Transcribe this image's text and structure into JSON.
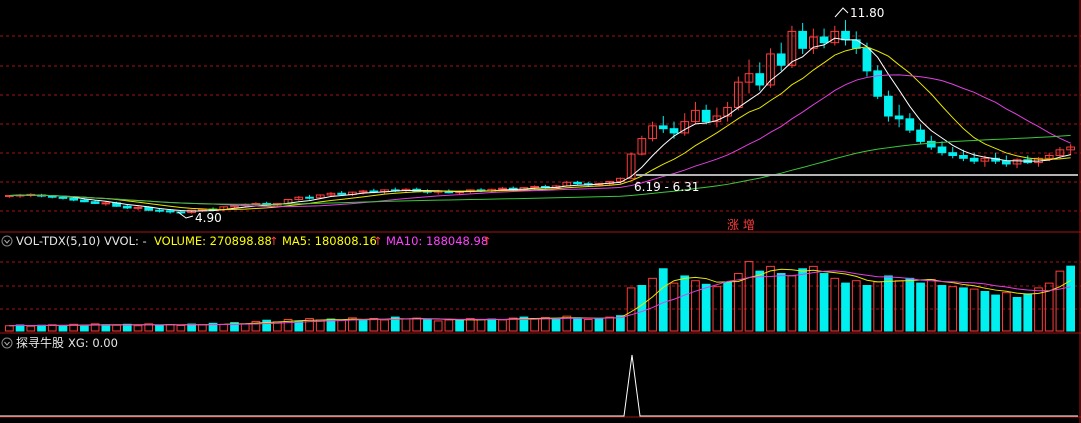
{
  "colors": {
    "background": "#000000",
    "grid": "#a01414",
    "up": "#ff3c3c",
    "down": "#00f0f0",
    "ma_white": "#ffffff",
    "ma_yellow": "#e6e600",
    "ma_magenta": "#e040e0",
    "ma_green": "#3cc83c",
    "support": "#b4b4b4",
    "panel_label": "#e6e6e6",
    "volume_label": "#ffff00",
    "ma5_label": "#ffff00",
    "ma10_label": "#ff40ff",
    "xg_line": "#ffffff",
    "annotation": "#ffffff"
  },
  "price_panel": {
    "high_annotation": "11.80",
    "low_annotation": "4.90",
    "range_annotation": "6.19 - 6.31",
    "signal_text": "涨   增"
  },
  "volume_panel": {
    "indicator": "VOL-TDX(5,10)",
    "vvol": "VVOL: -",
    "volume": "VOLUME: 270898.88",
    "ma5": "MA5: 180808.16",
    "ma10": "MA10: 188048.98",
    "up_arrow": "↑"
  },
  "xg_panel": {
    "title": "探寻牛股",
    "value": "XG: 0.00"
  },
  "chart_data": {
    "type": "candlestick",
    "price": {
      "ylim": [
        4.5,
        12.3
      ],
      "support_level": 6.31,
      "ohlc_profile": [
        [
          5.55,
          5.6,
          5.5,
          5.58
        ],
        [
          5.58,
          5.64,
          5.5,
          5.6
        ],
        [
          5.6,
          5.66,
          5.52,
          5.62
        ],
        [
          5.6,
          5.64,
          5.52,
          5.56
        ],
        [
          5.56,
          5.6,
          5.48,
          5.52
        ],
        [
          5.52,
          5.58,
          5.44,
          5.48
        ],
        [
          5.48,
          5.52,
          5.38,
          5.42
        ],
        [
          5.42,
          5.46,
          5.34,
          5.36
        ],
        [
          5.36,
          5.42,
          5.28,
          5.3
        ],
        [
          5.3,
          5.38,
          5.22,
          5.32
        ],
        [
          5.32,
          5.36,
          5.18,
          5.2
        ],
        [
          5.2,
          5.26,
          5.1,
          5.14
        ],
        [
          5.14,
          5.2,
          5.06,
          5.16
        ],
        [
          5.16,
          5.2,
          5.02,
          5.06
        ],
        [
          5.06,
          5.12,
          4.98,
          5.04
        ],
        [
          5.04,
          5.1,
          4.94,
          5.0
        ],
        [
          5.0,
          5.06,
          4.9,
          4.98
        ],
        [
          4.98,
          5.08,
          4.94,
          5.06
        ],
        [
          5.06,
          5.12,
          5.0,
          5.1
        ],
        [
          5.1,
          5.16,
          5.02,
          5.08
        ],
        [
          5.08,
          5.2,
          5.04,
          5.18
        ],
        [
          5.18,
          5.26,
          5.12,
          5.22
        ],
        [
          5.22,
          5.3,
          5.16,
          5.26
        ],
        [
          5.26,
          5.34,
          5.2,
          5.3
        ],
        [
          5.3,
          5.36,
          5.22,
          5.24
        ],
        [
          5.24,
          5.32,
          5.18,
          5.3
        ],
        [
          5.3,
          5.46,
          5.26,
          5.44
        ],
        [
          5.44,
          5.56,
          5.4,
          5.52
        ],
        [
          5.52,
          5.6,
          5.44,
          5.5
        ],
        [
          5.5,
          5.62,
          5.46,
          5.6
        ],
        [
          5.6,
          5.7,
          5.54,
          5.66
        ],
        [
          5.66,
          5.74,
          5.58,
          5.62
        ],
        [
          5.62,
          5.72,
          5.56,
          5.7
        ],
        [
          5.7,
          5.78,
          5.62,
          5.74
        ],
        [
          5.74,
          5.82,
          5.66,
          5.72
        ],
        [
          5.72,
          5.8,
          5.64,
          5.78
        ],
        [
          5.78,
          5.86,
          5.7,
          5.76
        ],
        [
          5.76,
          5.84,
          5.68,
          5.8
        ],
        [
          5.8,
          5.86,
          5.72,
          5.74
        ],
        [
          5.74,
          5.8,
          5.64,
          5.7
        ],
        [
          5.7,
          5.78,
          5.62,
          5.74
        ],
        [
          5.74,
          5.8,
          5.66,
          5.68
        ],
        [
          5.68,
          5.76,
          5.6,
          5.72
        ],
        [
          5.72,
          5.8,
          5.66,
          5.78
        ],
        [
          5.78,
          5.84,
          5.7,
          5.74
        ],
        [
          5.74,
          5.82,
          5.68,
          5.8
        ],
        [
          5.8,
          5.88,
          5.74,
          5.84
        ],
        [
          5.84,
          5.9,
          5.76,
          5.8
        ],
        [
          5.8,
          5.88,
          5.74,
          5.86
        ],
        [
          5.86,
          5.94,
          5.8,
          5.9
        ],
        [
          5.9,
          5.96,
          5.82,
          5.86
        ],
        [
          5.86,
          5.96,
          5.82,
          5.92
        ],
        [
          5.92,
          6.1,
          5.9,
          6.05
        ],
        [
          6.05,
          6.1,
          5.96,
          6.0
        ],
        [
          6.0,
          6.06,
          5.92,
          5.96
        ],
        [
          5.96,
          6.04,
          5.9,
          6.0
        ],
        [
          6.0,
          6.1,
          5.95,
          6.08
        ],
        [
          6.08,
          6.22,
          6.0,
          6.19
        ],
        [
          6.19,
          7.1,
          6.19,
          7.05
        ],
        [
          7.05,
          7.7,
          7.0,
          7.6
        ],
        [
          7.6,
          8.2,
          7.5,
          8.05
        ],
        [
          8.05,
          8.4,
          7.8,
          7.95
        ],
        [
          7.95,
          8.2,
          7.6,
          7.8
        ],
        [
          7.8,
          8.5,
          7.7,
          8.2
        ],
        [
          8.2,
          8.9,
          8.1,
          8.6
        ],
        [
          8.6,
          8.8,
          8.1,
          8.2
        ],
        [
          8.2,
          8.7,
          8.0,
          8.4
        ],
        [
          8.4,
          8.9,
          8.2,
          8.7
        ],
        [
          8.7,
          9.8,
          8.6,
          9.6
        ],
        [
          9.6,
          10.4,
          9.2,
          9.9
        ],
        [
          9.9,
          10.3,
          9.3,
          9.5
        ],
        [
          9.5,
          10.8,
          9.4,
          10.6
        ],
        [
          10.6,
          11.0,
          10.0,
          10.2
        ],
        [
          10.2,
          11.6,
          10.1,
          11.4
        ],
        [
          11.4,
          11.7,
          10.6,
          10.8
        ],
        [
          10.8,
          11.5,
          10.6,
          11.2
        ],
        [
          11.2,
          11.5,
          10.8,
          11.0
        ],
        [
          11.0,
          11.6,
          10.9,
          11.4
        ],
        [
          11.4,
          11.8,
          10.9,
          11.1
        ],
        [
          11.1,
          11.4,
          10.6,
          10.8
        ],
        [
          10.8,
          11.0,
          9.8,
          10.0
        ],
        [
          10.0,
          10.2,
          9.0,
          9.1
        ],
        [
          9.1,
          9.3,
          8.2,
          8.4
        ],
        [
          8.4,
          8.8,
          8.0,
          8.3
        ],
        [
          8.3,
          8.5,
          7.8,
          7.9
        ],
        [
          7.9,
          8.1,
          7.4,
          7.5
        ],
        [
          7.5,
          7.7,
          7.2,
          7.3
        ],
        [
          7.3,
          7.5,
          7.0,
          7.1
        ],
        [
          7.1,
          7.3,
          6.9,
          7.0
        ],
        [
          7.0,
          7.2,
          6.8,
          6.9
        ],
        [
          6.9,
          7.1,
          6.7,
          6.8
        ],
        [
          6.8,
          7.0,
          6.6,
          6.9
        ],
        [
          6.9,
          7.1,
          6.7,
          6.8
        ],
        [
          6.8,
          7.0,
          6.6,
          6.7
        ],
        [
          6.7,
          6.9,
          6.55,
          6.85
        ],
        [
          6.85,
          7.0,
          6.7,
          6.75
        ],
        [
          6.75,
          6.95,
          6.6,
          6.9
        ],
        [
          6.9,
          7.1,
          6.8,
          7.0
        ],
        [
          7.0,
          7.3,
          6.9,
          7.2
        ],
        [
          7.2,
          7.4,
          7.0,
          7.3
        ]
      ]
    },
    "volume": {
      "ylim": [
        0,
        330000
      ],
      "series_profile": [
        [
          22000,
          1
        ],
        [
          25000,
          0
        ],
        [
          20000,
          1
        ],
        [
          24000,
          0
        ],
        [
          26000,
          1
        ],
        [
          23000,
          0
        ],
        [
          28000,
          1
        ],
        [
          22000,
          0
        ],
        [
          30000,
          1
        ],
        [
          26000,
          0
        ],
        [
          24000,
          1
        ],
        [
          28000,
          0
        ],
        [
          22000,
          1
        ],
        [
          30000,
          1
        ],
        [
          25000,
          0
        ],
        [
          27000,
          1
        ],
        [
          23000,
          1
        ],
        [
          29000,
          0
        ],
        [
          26000,
          1
        ],
        [
          32000,
          0
        ],
        [
          28000,
          1
        ],
        [
          35000,
          0
        ],
        [
          30000,
          1
        ],
        [
          40000,
          1
        ],
        [
          45000,
          0
        ],
        [
          38000,
          1
        ],
        [
          48000,
          1
        ],
        [
          42000,
          0
        ],
        [
          52000,
          1
        ],
        [
          46000,
          1
        ],
        [
          50000,
          0
        ],
        [
          44000,
          1
        ],
        [
          55000,
          1
        ],
        [
          48000,
          0
        ],
        [
          52000,
          1
        ],
        [
          46000,
          1
        ],
        [
          58000,
          0
        ],
        [
          50000,
          1
        ],
        [
          54000,
          1
        ],
        [
          48000,
          0
        ],
        [
          42000,
          1
        ],
        [
          46000,
          1
        ],
        [
          44000,
          0
        ],
        [
          52000,
          1
        ],
        [
          48000,
          1
        ],
        [
          50000,
          0
        ],
        [
          46000,
          1
        ],
        [
          54000,
          1
        ],
        [
          58000,
          0
        ],
        [
          52000,
          1
        ],
        [
          56000,
          1
        ],
        [
          50000,
          0
        ],
        [
          62000,
          1
        ],
        [
          55000,
          0
        ],
        [
          48000,
          1
        ],
        [
          52000,
          0
        ],
        [
          58000,
          1
        ],
        [
          64000,
          0
        ],
        [
          180000,
          1
        ],
        [
          190000,
          0
        ],
        [
          220000,
          1
        ],
        [
          260000,
          0
        ],
        [
          200000,
          1
        ],
        [
          230000,
          0
        ],
        [
          210000,
          1
        ],
        [
          195000,
          0
        ],
        [
          185000,
          1
        ],
        [
          205000,
          0
        ],
        [
          240000,
          1
        ],
        [
          290000,
          1
        ],
        [
          250000,
          0
        ],
        [
          270000,
          1
        ],
        [
          240000,
          0
        ],
        [
          230000,
          1
        ],
        [
          260000,
          0
        ],
        [
          270000,
          1
        ],
        [
          240000,
          0
        ],
        [
          220000,
          1
        ],
        [
          200000,
          0
        ],
        [
          210000,
          1
        ],
        [
          190000,
          0
        ],
        [
          205000,
          1
        ],
        [
          230000,
          0
        ],
        [
          210000,
          1
        ],
        [
          220000,
          0
        ],
        [
          200000,
          0
        ],
        [
          215000,
          1
        ],
        [
          190000,
          0
        ],
        [
          185000,
          1
        ],
        [
          180000,
          0
        ],
        [
          175000,
          1
        ],
        [
          165000,
          0
        ],
        [
          150000,
          0
        ],
        [
          160000,
          1
        ],
        [
          140000,
          0
        ],
        [
          155000,
          0
        ],
        [
          180000,
          1
        ],
        [
          200000,
          1
        ],
        [
          250000,
          1
        ],
        [
          270898.88,
          0
        ]
      ]
    }
  }
}
